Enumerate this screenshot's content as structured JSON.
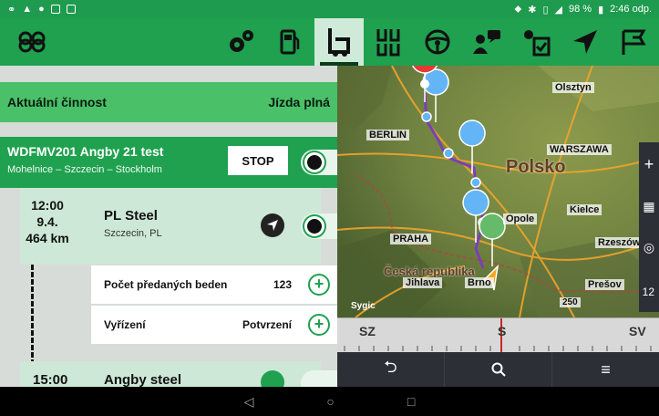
{
  "statusbar": {
    "battery": "98 %",
    "time": "2:46 odp."
  },
  "toolbar": {
    "items": [
      {
        "icon": "settings-gears-icon"
      },
      {
        "icon": "fuel-icon"
      },
      {
        "icon": "truck-icon",
        "active": true
      },
      {
        "icon": "trailer-axles-icon"
      },
      {
        "icon": "steering-wheel-icon"
      },
      {
        "icon": "driver-message-icon"
      },
      {
        "icon": "task-checklist-icon"
      },
      {
        "icon": "navigation-arrow-icon"
      },
      {
        "icon": "finish-flag-icon"
      }
    ]
  },
  "activity": {
    "label": "Aktuální činnost",
    "status": "Jízda plná"
  },
  "job": {
    "title": "WDFMV201 Angby 21 test",
    "route": "Mohelnice – Szczecin – Stockholm",
    "stop_label": "STOP"
  },
  "stop1": {
    "time": "12:00",
    "date": "9.4.",
    "distance": "464 km",
    "name": "PL Steel",
    "location": "Szczecin, PL"
  },
  "fields": [
    {
      "label": "Počet předaných beden",
      "value": "123"
    },
    {
      "label": "Vyřízení",
      "value": "Potvrzení"
    }
  ],
  "stop2": {
    "time": "15:00",
    "name": "Angby steel"
  },
  "map": {
    "labels": {
      "olsztyn": "Olsztyn",
      "berlin": "BERLIN",
      "warszawa": "WARSZAWA",
      "polsko": "Polsko",
      "kielce": "Kielce",
      "opole": "Opole",
      "praha": "PRAHA",
      "rzeszow": "Rzeszów",
      "ceska": "Česká republika",
      "jihlava": "Jihlava",
      "brno": "Brno",
      "presov": "Prešov",
      "sygic": "Sygic",
      "scale": "250",
      "badge": "12"
    },
    "compass": {
      "left": "SZ",
      "center": "S",
      "right": "SV"
    }
  },
  "colors": {
    "primary": "#1fa14f",
    "route": "#7b3fb5",
    "pin_red": "#e53935",
    "pin_blue": "#64b5f6",
    "pin_green": "#66bb6a"
  }
}
